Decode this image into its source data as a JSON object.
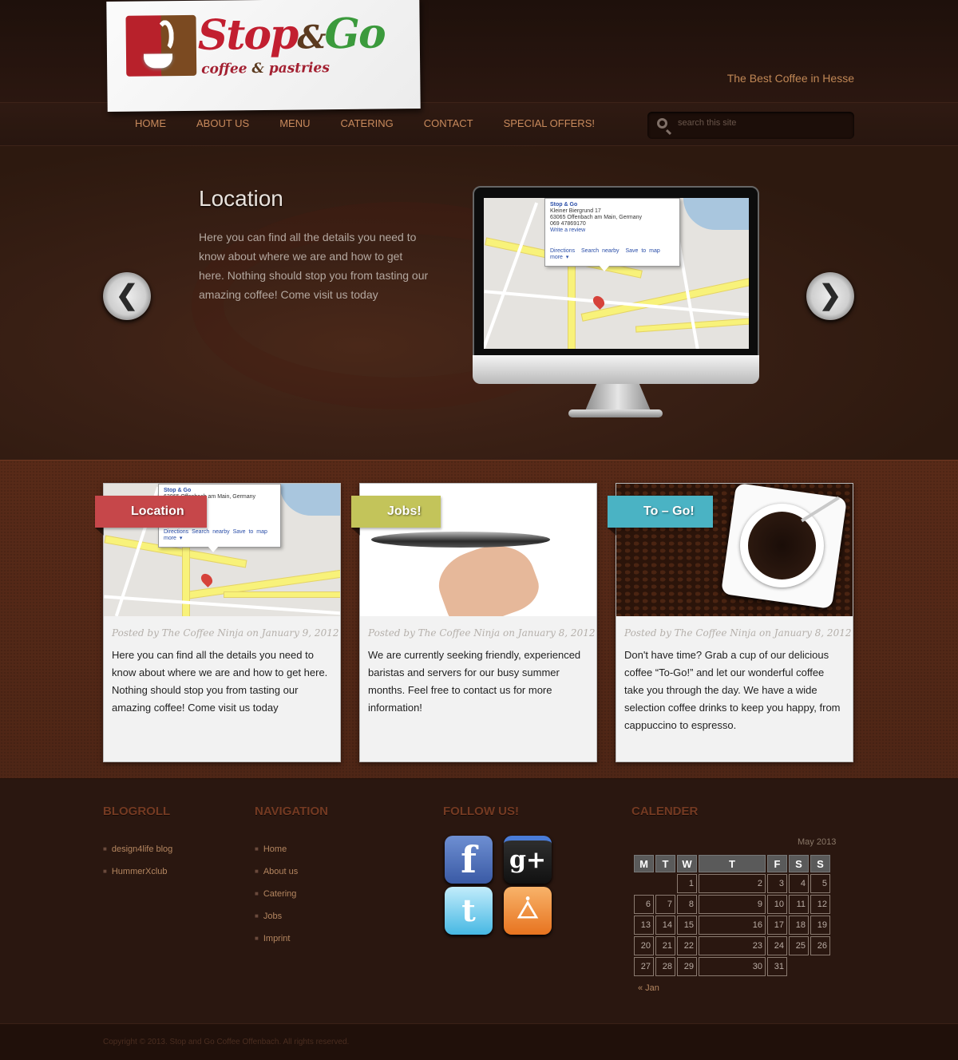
{
  "brand": {
    "stop": "Stop",
    "amp": "&",
    "go": "Go",
    "sub_a": "coffee",
    "sub_amp": "&",
    "sub_b": "pastries",
    "tagline": "The Best Coffee in Hesse"
  },
  "nav": {
    "items": [
      "HOME",
      "ABOUT US",
      "MENU",
      "CATERING",
      "CONTACT",
      "SPECIAL OFFERS!"
    ]
  },
  "search": {
    "placeholder": "search this site"
  },
  "hero": {
    "title": "Location",
    "text": "Here you can find all the details you need to know about where we are and how to get here. Nothing should stop you from tasting our amazing coffee! Come visit us today",
    "map_bubble": {
      "name": "Stop & Go",
      "address1": "Kleiner Biergrund 17",
      "address2": "63065 Offenbach am Main, Germany",
      "phone": "069 47869170",
      "review": "Write a review",
      "links": [
        "Directions",
        "Search nearby",
        "Save to map",
        "more ▾"
      ]
    }
  },
  "cards": [
    {
      "label": "Location",
      "color": "#c6474a",
      "meta": "Posted by The Coffee Ninja on January 9, 2012",
      "text": "Here you can find all the details you need to know about where we are and how to get here. Nothing should stop you from tasting our amazing coffee! Come visit us today"
    },
    {
      "label": "Jobs!",
      "color": "#c3c45a",
      "meta": "Posted by The Coffee Ninja on January 8, 2012",
      "text": "We are currently seeking friendly, experienced baristas and servers for our busy summer months. Feel free to contact us for more information!"
    },
    {
      "label": "To – Go!",
      "color": "#4ab3c4",
      "meta": "Posted by The Coffee Ninja on January 8, 2012",
      "text": "Don't have time? Grab a cup of our delicious coffee “To-Go!” and let our wonderful coffee take you through the day. We have a wide selection coffee drinks to keep you happy, from cappuccino to espresso."
    }
  ],
  "footer": {
    "blogroll": {
      "title": "BLOGROLL",
      "items": [
        "design4life blog",
        "HummerXclub"
      ]
    },
    "navigation": {
      "title": "NAVIGATION",
      "items": [
        "Home",
        "About us",
        "Catering",
        "Jobs",
        "Imprint"
      ]
    },
    "follow": {
      "title": "FOLLOW US!",
      "icons": [
        "facebook-icon",
        "google-plus-icon",
        "twitter-icon",
        "rss-icon"
      ]
    },
    "calendar": {
      "title": "CALENDER",
      "caption": "May 2013",
      "days": [
        "M",
        "T",
        "W",
        "T",
        "F",
        "S",
        "S"
      ],
      "weeks": [
        [
          "",
          "",
          "1",
          "2",
          "3",
          "4",
          "5"
        ],
        [
          "6",
          "7",
          "8",
          "9",
          "10",
          "11",
          "12"
        ],
        [
          "13",
          "14",
          "15",
          "16",
          "17",
          "18",
          "19"
        ],
        [
          "20",
          "21",
          "22",
          "23",
          "24",
          "25",
          "26"
        ],
        [
          "27",
          "28",
          "29",
          "30",
          "31",
          "",
          ""
        ]
      ],
      "prev": "« Jan"
    },
    "copyright": "Copyright © 2013. Stop and Go Coffee Offenbach. All rights reserved."
  }
}
